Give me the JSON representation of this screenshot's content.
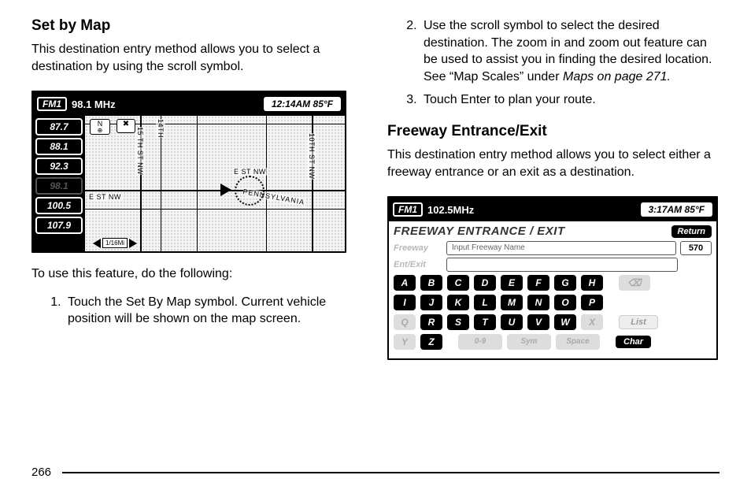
{
  "page_number": "266",
  "left": {
    "heading": "Set by Map",
    "intro": "This destination entry method allows you to select a destination by using the scroll symbol.",
    "lead_out": "To use this feature, do the following:",
    "step1": "Touch the Set By Map symbol. Current vehicle position will be shown on the map screen."
  },
  "right": {
    "step2": "Use the scroll symbol to select the desired destination. The zoom in and zoom out feature can be used to assist you in finding the desired location. See “Map Scales” under ",
    "step2_ref": "Maps on page 271.",
    "step3": "Touch Enter to plan your route.",
    "heading": "Freeway Entrance/Exit",
    "intro": "This destination entry method allows you to select either a freeway entrance or an exit as a destination."
  },
  "fig1": {
    "band": "FM1",
    "freq": "98.1 MHz",
    "time": "12:14AM 85°F",
    "presets": [
      "87.7",
      "88.1",
      "92.3",
      "98.1",
      "100.5",
      "107.9"
    ],
    "compass": "N",
    "scale": "1/16Mi",
    "streets": {
      "s14": "14TH",
      "s15": "15 TH ST NW",
      "s10": "10TH ST NW",
      "est1": "E ST NW",
      "est2": "E ST NW",
      "penn": "PENNSYLVANIA"
    }
  },
  "fig2": {
    "band": "FM1",
    "freq": "102.5MHz",
    "time": "3:17AM 85°F",
    "subtitle": "FREEWAY ENTRANCE / EXIT",
    "return": "Return",
    "row1_label": "Freeway",
    "row1_placeholder": "Input Freeway  Name",
    "row1_count": "570",
    "row2_label": "Ent/Exit",
    "list": "List",
    "char": "Char",
    "keys": {
      "r1": [
        "A",
        "B",
        "C",
        "D",
        "E",
        "F",
        "G",
        "H"
      ],
      "r2": [
        "I",
        "J",
        "K",
        "L",
        "M",
        "N",
        "O",
        "P"
      ],
      "r3": [
        "Q",
        "R",
        "S",
        "T",
        "U",
        "V",
        "W",
        "X"
      ],
      "r4": [
        "Y",
        "Z"
      ],
      "r4b": [
        "0-9",
        "Sym",
        "Space"
      ]
    }
  }
}
